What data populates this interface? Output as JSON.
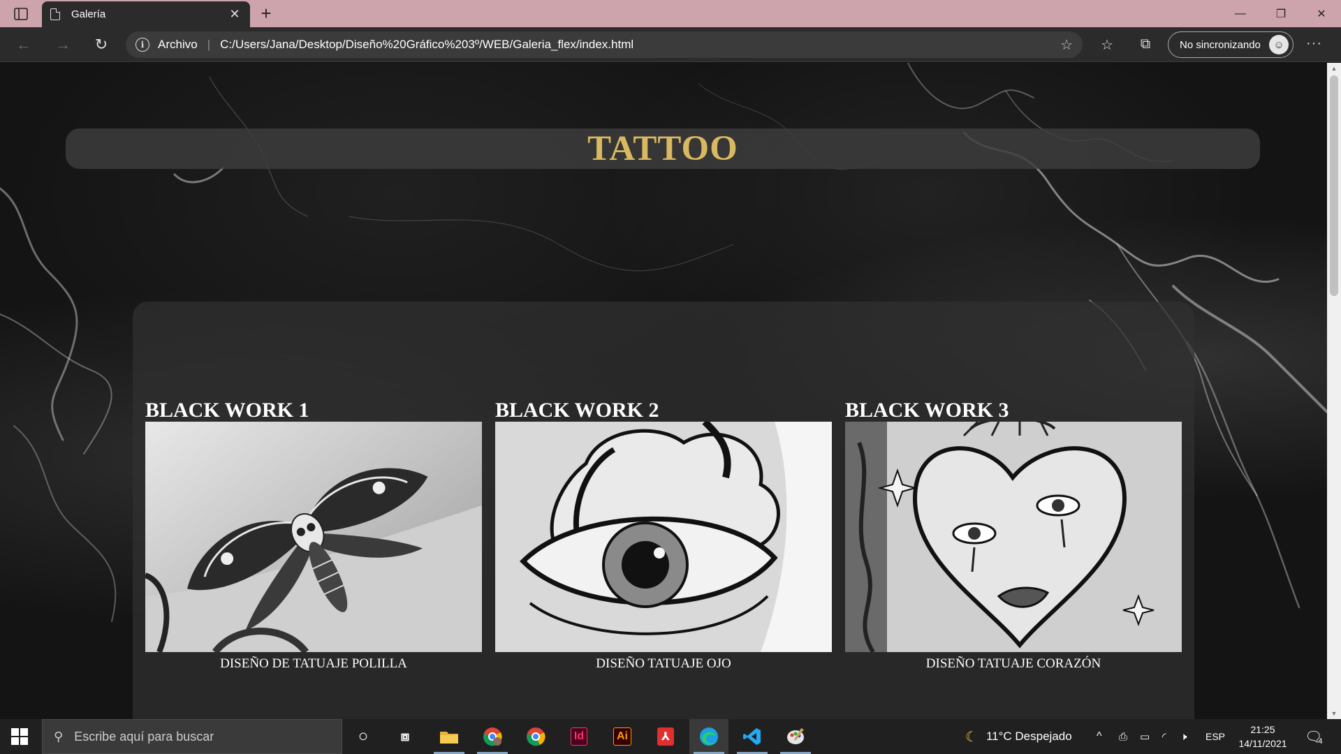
{
  "browser": {
    "tab_title": "Galería",
    "new_tab_label": "+",
    "close_tab_label": "✕",
    "address": {
      "site_info_label": "Archivo",
      "url": "C:/Users/Jana/Desktop/Diseño%20Gráfico%203º/WEB/Galeria_flex/index.html"
    },
    "profile_label": "No sincronizando",
    "window_controls": {
      "minimize": "—",
      "restore": "❐",
      "close": "✕"
    }
  },
  "page": {
    "title": "TATTOO",
    "title_color": "#d8b860",
    "cards": [
      {
        "heading": "BLACK WORK 1",
        "caption": "DISEÑO DE TATUAJE POLILLA",
        "image_subject": "moth-skull-tattoo"
      },
      {
        "heading": "BLACK WORK 2",
        "caption": "DISEÑO TATUAJE OJO",
        "image_subject": "eye-cloud-tattoo"
      },
      {
        "heading": "BLACK WORK 3",
        "caption": "DISEÑO TATUAJE CORAZÓN",
        "image_subject": "heart-face-tattoo"
      }
    ]
  },
  "taskbar": {
    "search_placeholder": "Escribe aquí para buscar",
    "weather": "11°C  Despejado",
    "language": "ESP",
    "time": "21:25",
    "date": "14/11/2021",
    "notification_count": "4",
    "apps": [
      "task-view",
      "file-explorer",
      "chrome-profile",
      "chrome",
      "indesign",
      "illustrator",
      "acrobat",
      "edge",
      "vscode",
      "paint"
    ]
  }
}
